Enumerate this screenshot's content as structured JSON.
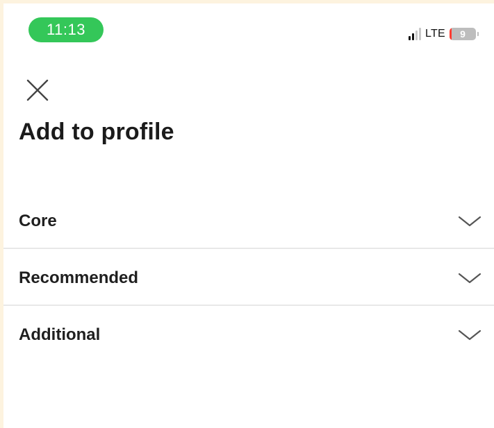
{
  "status_bar": {
    "time": "11:13",
    "network": "LTE",
    "battery_level": "9",
    "signal_strength": 2,
    "colors": {
      "time_pill": "#34c759",
      "battery_low": "#ff3b30"
    }
  },
  "header": {
    "close_icon": "close-icon",
    "title": "Add to profile"
  },
  "sections": [
    {
      "label": "Core",
      "icon": "chevron-down-icon"
    },
    {
      "label": "Recommended",
      "icon": "chevron-down-icon"
    },
    {
      "label": "Additional",
      "icon": "chevron-down-icon"
    }
  ]
}
